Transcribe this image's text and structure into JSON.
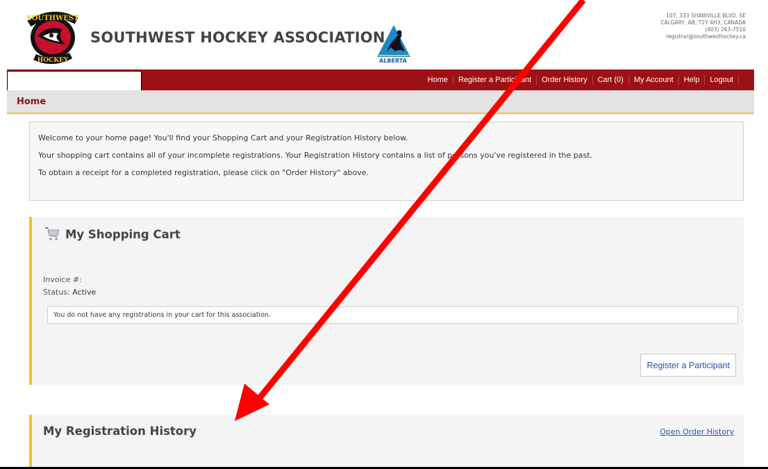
{
  "header": {
    "title": "SOUTHWEST HOCKEY ASSOCIATION",
    "logo_text_top": "SOUTHWEST",
    "logo_text_bottom": "HOCKEY",
    "alberta_logo_text": "ALBERTA",
    "address": {
      "line1": "107, 333 SHAWVILLE BLVD. SE",
      "line2": "CALGARY, AB, T2Y 4H3, CANADA",
      "line3": "(403) 263-7510",
      "line4": "registrar@southwesthockey.ca"
    }
  },
  "nav": {
    "items": [
      {
        "label": "Home"
      },
      {
        "label": "Register a Participant"
      },
      {
        "label": "Order History"
      },
      {
        "label": "Cart (0)"
      },
      {
        "label": "My Account"
      },
      {
        "label": "Help"
      },
      {
        "label": "Logout"
      }
    ]
  },
  "page": {
    "title": "Home"
  },
  "welcome": {
    "line1": "Welcome to your home page! You'll find your Shopping Cart and your Registration History below.",
    "line2": "Your shopping cart contains all of your incomplete registrations. Your Registration History contains a list of persons you've registered in the past.",
    "line3": "To obtain a receipt for a completed registration, please click on \"Order History\" above."
  },
  "cart": {
    "title": "My Shopping Cart",
    "invoice_label": "Invoice #:",
    "status_label": "Status:",
    "status_value": "Active",
    "empty_message": "You do not have any registrations in your cart for this association.",
    "register_button": "Register a Participant"
  },
  "history": {
    "title": "My Registration History",
    "link": "Open Order History"
  },
  "colors": {
    "nav_bg": "#9d1116",
    "accent_yellow": "#f6c21a",
    "link_blue": "#2a4fb6",
    "arrow_red": "#ff0000"
  },
  "icons": [
    "shopping-cart-icon",
    "annotation-arrow"
  ]
}
